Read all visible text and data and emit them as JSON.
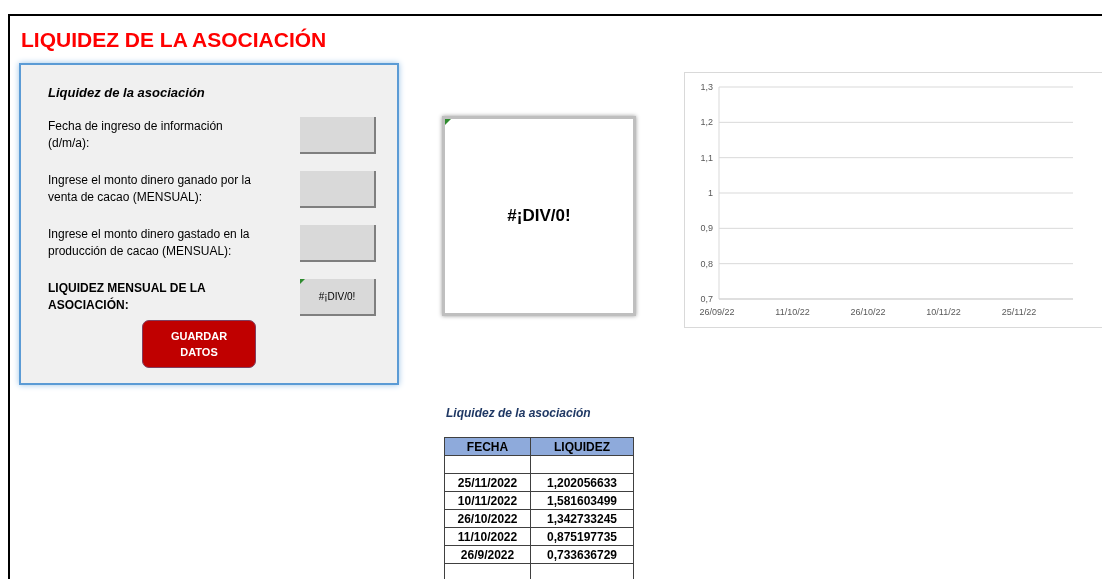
{
  "title": "LIQUIDEZ DE LA ASOCIACIÓN",
  "form": {
    "heading": "Liquidez de la asociación",
    "fields": [
      {
        "label": "Fecha de ingreso de información (d/m/a):"
      },
      {
        "label": "Ingrese el monto dinero ganado por la venta de cacao (MENSUAL):"
      },
      {
        "label": "Ingrese el monto dinero gastado en la producción de cacao (MENSUAL):"
      }
    ],
    "result": {
      "label": "LIQUIDEZ MENSUAL DE LA ASOCIACIÓN:",
      "value": "#¡DIV/0!"
    },
    "button": "GUARDAR DATOS"
  },
  "result_box": {
    "value": "#¡DIV/0!"
  },
  "chart": {
    "chart_data": {
      "type": "line",
      "grid": true,
      "categories": [
        "26/09/22",
        "11/10/22",
        "26/10/22",
        "10/11/22",
        "25/11/22"
      ],
      "ylim": [
        0.7,
        1.3
      ],
      "yticks": [
        {
          "value": 0.7,
          "label": "0,7"
        },
        {
          "value": 0.8,
          "label": "0,8"
        },
        {
          "value": 0.9,
          "label": "0,9"
        },
        {
          "value": 1,
          "label": "1"
        },
        {
          "value": 1.1,
          "label": "1,1"
        },
        {
          "value": 1.2,
          "label": "1,2"
        },
        {
          "value": 1.3,
          "label": "1,3"
        }
      ]
    }
  },
  "table": {
    "title": "Liquidez de la asociación",
    "columns": [
      "FECHA",
      "LIQUIDEZ"
    ],
    "rows": [
      [
        "25/11/2022",
        "1,202056633"
      ],
      [
        "10/11/2022",
        "1,581603499"
      ],
      [
        "26/10/2022",
        "1,342733245"
      ],
      [
        "11/10/2022",
        "0,875197735"
      ],
      [
        "26/9/2022",
        "0,733636729"
      ]
    ]
  }
}
